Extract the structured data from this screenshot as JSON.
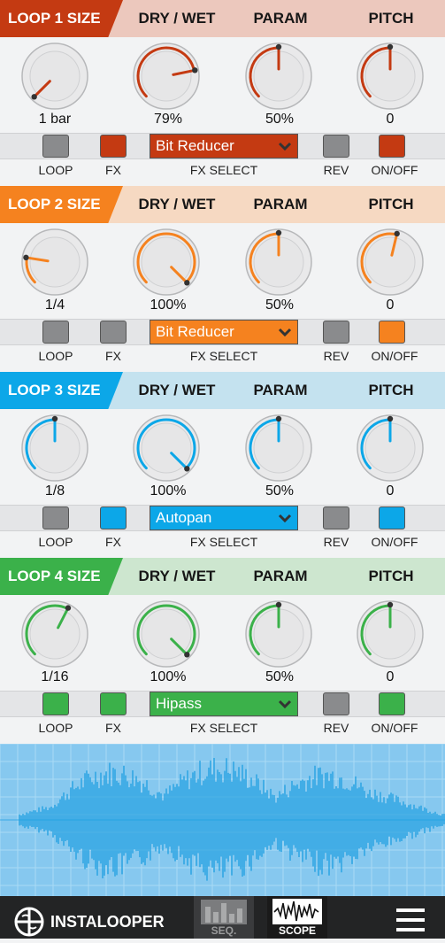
{
  "loops": [
    {
      "title": "LOOP 1 SIZE",
      "dry_wet": "DRY / WET",
      "param": "PARAM",
      "pitch": "PITCH",
      "size_value": "1 bar",
      "drywet_value": "79%",
      "param_value": "50%",
      "pitch_value": "0",
      "size_level": 0.0,
      "drywet_level": 0.79,
      "param_level": 0.5,
      "pitch_level": 0.5,
      "fx_select": "Bit Reducer",
      "loop_on": false,
      "fx_on": true,
      "rev_on": false,
      "onoff_on": true,
      "colors": {
        "accent": "#c43a12",
        "header_bg": "#ecc8bd",
        "empty": "#d9d9d9"
      },
      "labels": {
        "loop": "LOOP",
        "fx": "FX",
        "fx_select": "FX SELECT",
        "rev": "REV",
        "onoff": "ON/OFF"
      }
    },
    {
      "title": "LOOP 2 SIZE",
      "dry_wet": "DRY / WET",
      "param": "PARAM",
      "pitch": "PITCH",
      "size_value": "1/4",
      "drywet_value": "100%",
      "param_value": "50%",
      "pitch_value": "0",
      "size_level": 0.2,
      "drywet_level": 1.0,
      "param_level": 0.5,
      "pitch_level": 0.55,
      "fx_select": "Bit Reducer",
      "loop_on": false,
      "fx_on": false,
      "rev_on": false,
      "onoff_on": true,
      "colors": {
        "accent": "#f5821f",
        "header_bg": "#f6d9c2",
        "empty": "#d9d9d9"
      },
      "labels": {
        "loop": "LOOP",
        "fx": "FX",
        "fx_select": "FX SELECT",
        "rev": "REV",
        "onoff": "ON/OFF"
      }
    },
    {
      "title": "LOOP 3 SIZE",
      "dry_wet": "DRY / WET",
      "param": "PARAM",
      "pitch": "PITCH",
      "size_value": "1/8",
      "drywet_value": "100%",
      "param_value": "50%",
      "pitch_value": "0",
      "size_level": 0.5,
      "drywet_level": 1.0,
      "param_level": 0.5,
      "pitch_level": 0.5,
      "fx_select": "Autopan",
      "loop_on": false,
      "fx_on": true,
      "rev_on": false,
      "onoff_on": true,
      "colors": {
        "accent": "#0ca7e8",
        "header_bg": "#c4e2ef",
        "empty": "#d9d9d9"
      },
      "labels": {
        "loop": "LOOP",
        "fx": "FX",
        "fx_select": "FX SELECT",
        "rev": "REV",
        "onoff": "ON/OFF"
      }
    },
    {
      "title": "LOOP 4 SIZE",
      "dry_wet": "DRY / WET",
      "param": "PARAM",
      "pitch": "PITCH",
      "size_value": "1/16",
      "drywet_value": "100%",
      "param_value": "50%",
      "pitch_value": "0",
      "size_level": 0.6,
      "drywet_level": 1.0,
      "param_level": 0.5,
      "pitch_level": 0.5,
      "fx_select": "Hipass",
      "loop_on": true,
      "fx_on": true,
      "rev_on": false,
      "onoff_on": true,
      "colors": {
        "accent": "#3bb14a",
        "header_bg": "#cde6cf",
        "empty": "#d9d9d9"
      },
      "labels": {
        "loop": "LOOP",
        "fx": "FX",
        "fx_select": "FX SELECT",
        "rev": "REV",
        "onoff": "ON/OFF"
      }
    }
  ],
  "scope": {
    "bg": "#86c8ef",
    "grid": "#a9daf5",
    "wave": "#1e9fe0"
  },
  "bottom_bar": {
    "brand": "INSTALOOPER",
    "seq_label": "SEQ.",
    "scope_label": "SCOPE",
    "active": "scope"
  }
}
